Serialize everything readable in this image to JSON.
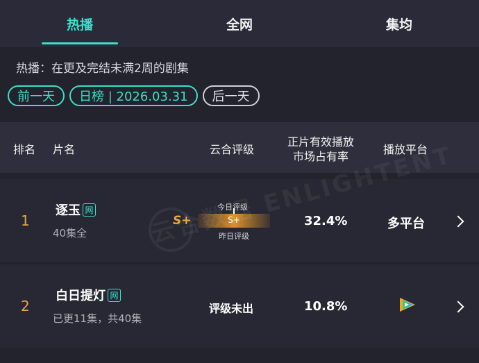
{
  "tabs": [
    {
      "label": "热播",
      "active": true
    },
    {
      "label": "全网",
      "active": false
    },
    {
      "label": "集均",
      "active": false
    }
  ],
  "description": "热播：在更及完结未满2周的剧集",
  "date_nav": {
    "prev": "前一天",
    "current": "日榜 | 2026.03.31",
    "next": "后一天"
  },
  "columns": {
    "rank": "排名",
    "title": "片名",
    "rating": "云合评级",
    "share_line1": "正片有效播放",
    "share_line2": "市场占有率",
    "platform": "播放平台"
  },
  "rows": [
    {
      "rank": "1",
      "title": "逐玉",
      "badge": "网",
      "episodes": "40集全",
      "grade": "S+",
      "today_label": "今日评级",
      "today_grade": "S+",
      "yesterday_label": "昨日评级",
      "share": "32.4%",
      "platform": "多平台"
    },
    {
      "rank": "2",
      "title": "白日提灯",
      "badge": "网",
      "episodes": "已更11集，共40集",
      "grade_status": "评级未出",
      "share": "10.8%",
      "platform_icon": "tencent-video-icon"
    }
  ],
  "watermark": "云合数据 ENLIGHTENT",
  "colors": {
    "accent": "#3be0c8",
    "rank": "#e4a942",
    "grade": "#f0a935",
    "background": "#23232e"
  }
}
